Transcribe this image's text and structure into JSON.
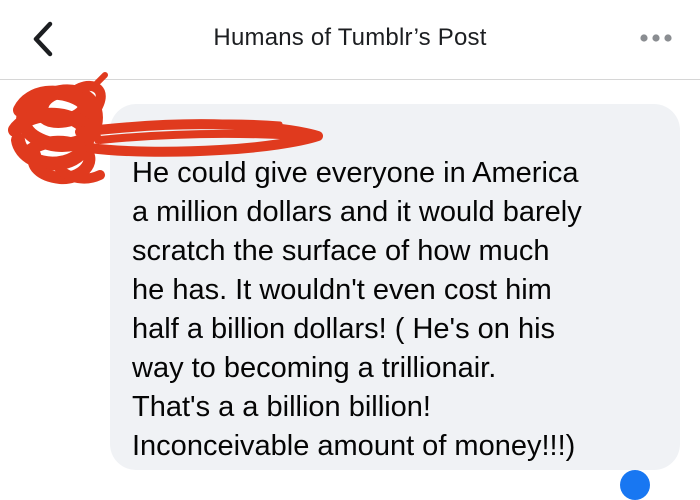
{
  "header": {
    "title": "Humans of Tumblr’s Post",
    "back_icon": "chevron-left-icon",
    "more_icon": "more-horizontal-icon"
  },
  "comment": {
    "author_name": "",
    "text": "He could give everyone in America\na million dollars and it would barely\nscratch the surface of how much\nhe has. It wouldn't even cost him\nhalf a billion dollars! ( He's on his\nway to becoming a trillionair.\nThat's a a billion billion!\nInconceivable amount of money!!!)"
  },
  "colors": {
    "bubble": "#f0f2f5",
    "text": "#050505",
    "redaction": "#e03a1e",
    "reaction": "#1877f2"
  }
}
